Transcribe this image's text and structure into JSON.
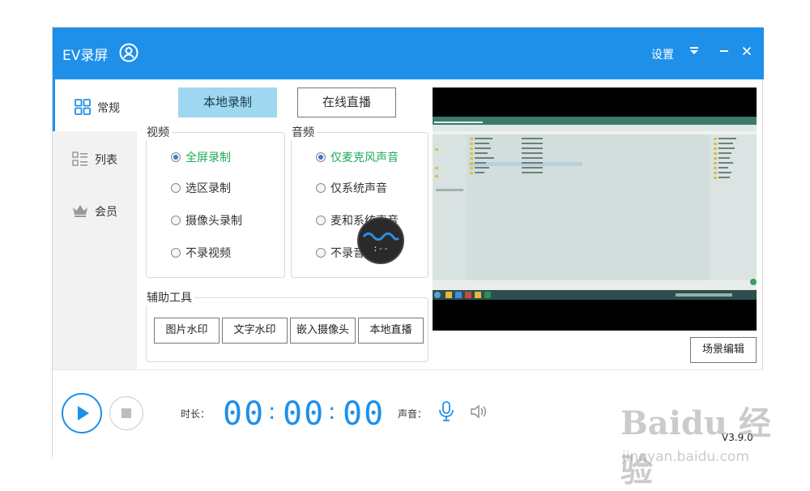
{
  "window": {
    "title": "EV录屏",
    "settings_label": "设置"
  },
  "sidebar": {
    "items": [
      {
        "label": "常规"
      },
      {
        "label": "列表"
      },
      {
        "label": "会员"
      }
    ]
  },
  "modes": {
    "local": "本地录制",
    "live": "在线直播"
  },
  "video": {
    "title": "视频",
    "options": [
      {
        "label": "全屏录制"
      },
      {
        "label": "选区录制"
      },
      {
        "label": "摄像头录制"
      },
      {
        "label": "不录视频"
      }
    ],
    "selected": "全屏录制"
  },
  "audio": {
    "title": "音频",
    "options": [
      {
        "label": "仅麦克风声音"
      },
      {
        "label": "仅系统声音"
      },
      {
        "label": "麦和系统声音"
      },
      {
        "label": "不录音频"
      }
    ],
    "selected": "仅麦克风声音"
  },
  "tools": {
    "title": "辅助工具",
    "buttons": [
      {
        "label": "图片水印"
      },
      {
        "label": "文字水印"
      },
      {
        "label": "嵌入摄像头"
      },
      {
        "label": "本地直播"
      }
    ]
  },
  "scene_edit": "场景编辑",
  "timer": {
    "label": "时长：",
    "hours": "00",
    "minutes": "00",
    "seconds": "00"
  },
  "volume": {
    "label": "声音："
  },
  "float_ball": {
    "text": ":--"
  },
  "version": "V3.9.0",
  "watermark": {
    "brand": "Baidu 经验",
    "url": "jingyan.baidu.com"
  },
  "colors": {
    "accent": "#1e90ea",
    "active_mode": "#9fd7f0",
    "selected_option": "#1faa59"
  }
}
